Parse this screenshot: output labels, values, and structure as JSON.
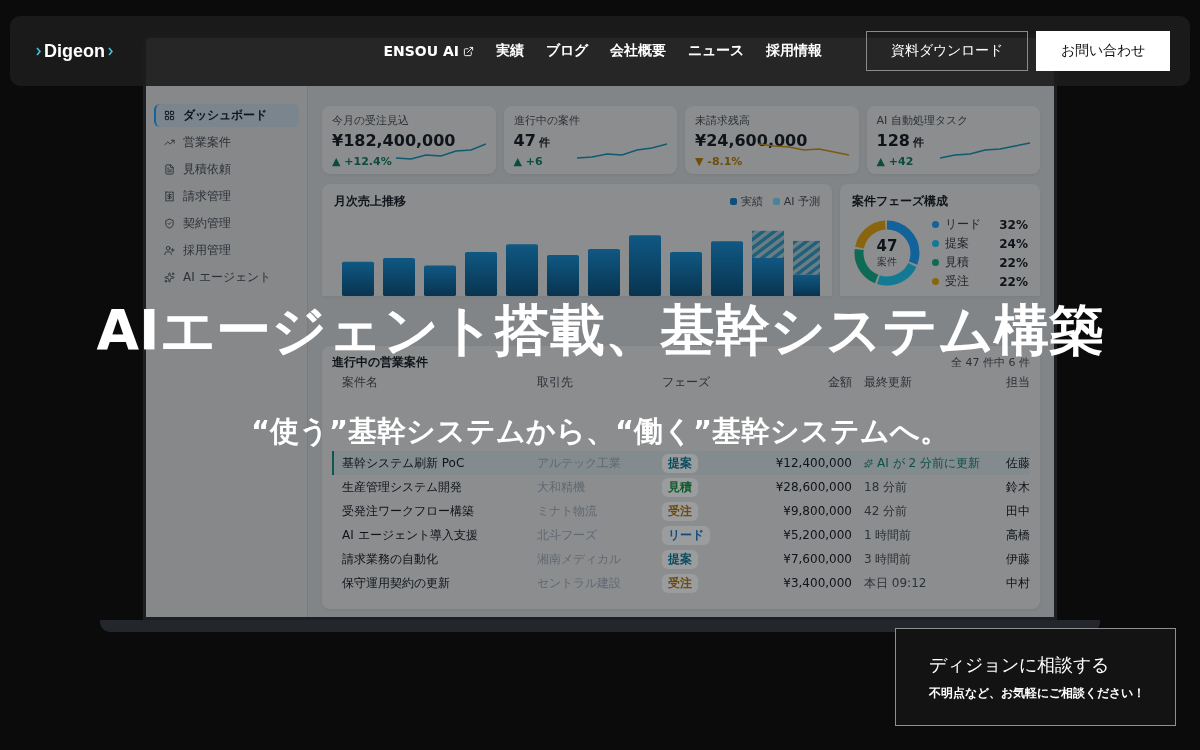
{
  "header": {
    "logo": "Digeon",
    "nav": [
      {
        "label": "ENSOU AI",
        "external": true
      },
      {
        "label": "実績",
        "external": false
      },
      {
        "label": "ブログ",
        "external": false
      },
      {
        "label": "会社概要",
        "external": false
      },
      {
        "label": "ニュース",
        "external": false
      },
      {
        "label": "採用情報",
        "external": false
      }
    ],
    "buttons": [
      {
        "label": "資料ダウンロード",
        "kind": "outline"
      },
      {
        "label": "お問い合わせ",
        "kind": "solid"
      }
    ]
  },
  "dashboard": {
    "sidebar": [
      {
        "label": "ダッシュボード",
        "selected": true
      },
      {
        "label": "営業案件",
        "selected": false
      },
      {
        "label": "見積依頼",
        "selected": false
      },
      {
        "label": "請求管理",
        "selected": false
      },
      {
        "label": "契約管理",
        "selected": false
      },
      {
        "label": "採用管理",
        "selected": false
      },
      {
        "label": "AI エージェント",
        "selected": false
      }
    ],
    "kpis": [
      {
        "label": "今月の受注見込",
        "value": "¥182,400,000",
        "arrow": "▲",
        "delta": "+12.4%",
        "rising": true
      },
      {
        "label": "進行中の案件",
        "value": "47",
        "unit": "件",
        "arrow": "▲",
        "delta": "+6",
        "rising": true
      },
      {
        "label": "未請求残高",
        "value": "¥24,600,000",
        "arrow": "▼",
        "delta": "-8.1%",
        "rising": false
      },
      {
        "label": "AI 自動処理タスク",
        "value": "128",
        "unit": "件",
        "arrow": "▲",
        "delta": "+42",
        "rising": true
      }
    ],
    "revenue": {
      "title": "月次売上推移",
      "legend": [
        {
          "label": "実績",
          "kind": "actual"
        },
        {
          "label": "AI 予測",
          "kind": "forecast"
        }
      ]
    },
    "phases": {
      "title": "案件フェーズ構成",
      "center_value": "47",
      "center_label": "案件",
      "segments": [
        {
          "label": "リード",
          "share": "32%",
          "color": "#11639a"
        },
        {
          "label": "提案",
          "share": "24%",
          "color": "#137a94"
        },
        {
          "label": "見積",
          "share": "22%",
          "color": "#0c6a55"
        },
        {
          "label": "受注",
          "share": "22%",
          "color": "#8a6510"
        }
      ]
    },
    "deals": {
      "title": "進行中の営業案件",
      "count": "全 47 件中 6 件",
      "columns": [
        "案件名",
        "取引先",
        "フェーズ",
        "金額",
        "最終更新",
        "担当"
      ],
      "rows": [
        {
          "name": "基幹システム刷新 PoC",
          "client": "アルテック工業",
          "phase": {
            "label": "提案",
            "color": "#0a4d60"
          },
          "amount": "¥12,400,000",
          "updated": "AI が 2 分前に更新",
          "ai": true,
          "owner": "佐藤",
          "selected": true
        },
        {
          "name": "生産管理システム開発",
          "client": "大和精機",
          "phase": {
            "label": "見積",
            "color": "#0f5a2b"
          },
          "amount": "¥28,600,000",
          "updated": "18 分前",
          "ai": false,
          "owner": "鈴木",
          "selected": false
        },
        {
          "name": "受発注ワークフロー構築",
          "client": "ミナト物流",
          "phase": {
            "label": "受注",
            "color": "#6e4a0e"
          },
          "amount": "¥9,800,000",
          "updated": "42 分前",
          "ai": false,
          "owner": "田中",
          "selected": false
        },
        {
          "name": "AI エージェント導入支援",
          "client": "北斗フーズ",
          "phase": {
            "label": "リード",
            "color": "#124a7c"
          },
          "amount": "¥5,200,000",
          "updated": "1 時間前",
          "ai": false,
          "owner": "高橋",
          "selected": false
        },
        {
          "name": "請求業務の自動化",
          "client": "湘南メディカル",
          "phase": {
            "label": "提案",
            "color": "#0a4d60"
          },
          "amount": "¥7,600,000",
          "updated": "3 時間前",
          "ai": false,
          "owner": "伊藤",
          "selected": false
        },
        {
          "name": "保守運用契約の更新",
          "client": "セントラル建設",
          "phase": {
            "label": "受注",
            "color": "#6e4a0e"
          },
          "amount": "¥3,400,000",
          "updated": "本日 09:12",
          "ai": false,
          "owner": "中村",
          "selected": false
        }
      ]
    }
  },
  "hero": {
    "title": "AIエージェント搭載、基幹システム構築",
    "subtitle": "“使う”基幹システムから、“働く”基幹システムへ。"
  },
  "cta": {
    "title": "ディジョンに相談する",
    "text": "不明点など、お気軽にご相談ください！"
  }
}
